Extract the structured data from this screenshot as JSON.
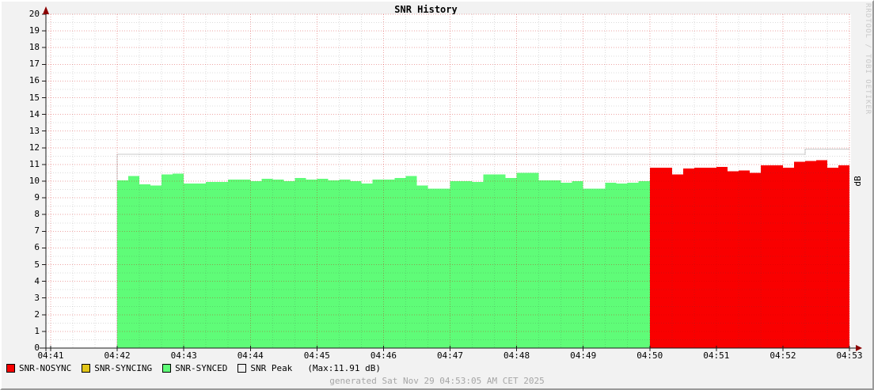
{
  "title": "SNR History",
  "footer": "generated Sat Nov 29 04:53:05 AM CET 2025",
  "watermark": "RRDTOOL / TOBI OETIKER",
  "legend": {
    "items": [
      {
        "label": "SNR-NOSYNC",
        "color": "#f90000"
      },
      {
        "label": "SNR-SYNCING",
        "color": "#e2c619"
      },
      {
        "label": "SNR-SYNCED",
        "color": "#5ffc78"
      },
      {
        "label": "SNR Peak",
        "color": "#f0f0f0"
      }
    ],
    "max_note": "(Max:11.91 dB)"
  },
  "colors": {
    "plot_bg": "#ffffff",
    "page_bg": "#f2f2f2",
    "major_grid": "rgba(205,0,0,0.35)",
    "minor_grid": "rgba(60,60,60,0.18)",
    "axis": "#1a1a1a",
    "arrow": "#8b0000",
    "peak_line": "#c9c9c9"
  },
  "chart_data": {
    "type": "area",
    "title": "SNR History",
    "ylabel_right": "dB",
    "ylim": [
      0,
      20
    ],
    "y_tick_step": 1,
    "grid": "dotted, major every 1 unit / 60 s, minor every 0.5 unit / 20 s",
    "legend_position": "bottom-left",
    "x_tick_labels": [
      "04:41",
      "04:42",
      "04:43",
      "04:44",
      "04:45",
      "04:46",
      "04:47",
      "04:48",
      "04:49",
      "04:50",
      "04:51",
      "04:52",
      "04:53"
    ],
    "x_tick_interval_sec": 60,
    "bar_interval_sec": 10,
    "series": [
      {
        "name": "SNR-SYNCED",
        "color": "#5ffc78",
        "start_sec": 60,
        "values": [
          10.05,
          10.3,
          9.8,
          9.75,
          10.4,
          10.45,
          9.85,
          9.85,
          9.95,
          9.95,
          10.1,
          10.1,
          10.0,
          10.15,
          10.1,
          10.0,
          10.2,
          10.1,
          10.15,
          10.05,
          10.1,
          10.0,
          9.85,
          10.1,
          10.1,
          10.2,
          10.3,
          9.75,
          9.55,
          9.55,
          10.0,
          10.0,
          9.95,
          10.4,
          10.4,
          10.2,
          10.5,
          10.5,
          10.05,
          10.05,
          9.9,
          10.0,
          9.55,
          9.55,
          9.9,
          9.85,
          9.9,
          10.0
        ]
      },
      {
        "name": "SNR-NOSYNC",
        "color": "#f90000",
        "start_sec": 540,
        "values": [
          10.8,
          10.8,
          10.4,
          10.75,
          10.8,
          10.8,
          10.85,
          10.6,
          10.65,
          10.5,
          10.95,
          10.95,
          10.8,
          11.15,
          11.2,
          11.25,
          10.8,
          10.95
        ]
      },
      {
        "name": "SNR-SYNCING",
        "color": "#e2c619",
        "start_sec": 0,
        "values": []
      }
    ],
    "peak_line": {
      "name": "SNR Peak",
      "color": "#c9c9c9",
      "max_label": "11.91 dB",
      "segments": [
        {
          "start_sec": 60,
          "end_sec": 680,
          "value": 11.6
        },
        {
          "start_sec": 680,
          "end_sec": 720,
          "value": 11.91
        }
      ]
    }
  }
}
